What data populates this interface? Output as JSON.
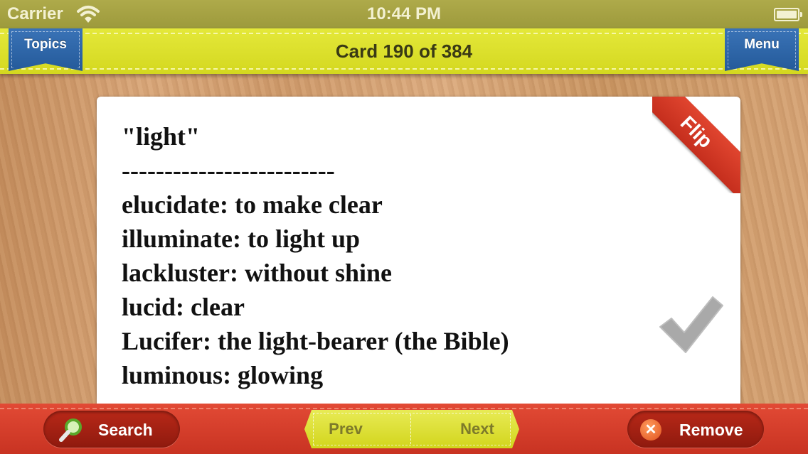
{
  "status_bar": {
    "carrier": "Carrier",
    "time": "10:44 PM"
  },
  "header": {
    "topics_label": "Topics",
    "card_counter": "Card 190 of 384",
    "menu_label": "Menu"
  },
  "card": {
    "flip_label": "Flip",
    "lines": [
      "\"light\"",
      "-------------------------",
      "elucidate: to make clear",
      "illuminate: to light up",
      "lackluster: without shine",
      "lucid: clear",
      "Lucifer: the light-bearer (the Bible)",
      "luminous: glowing"
    ]
  },
  "toolbar": {
    "search_label": "Search",
    "prev_label": "Prev",
    "next_label": "Next",
    "remove_label": "Remove"
  },
  "icons": {
    "search": "magnifier-icon",
    "check": "checkmark-icon",
    "remove": "x-circle-icon",
    "wifi": "wifi-icon",
    "battery": "battery-icon"
  },
  "colors": {
    "top_bar": "#d9dd26",
    "ribbon": "#2c64a8",
    "bottom_bar": "#d23c2a",
    "flip": "#d63a26"
  }
}
